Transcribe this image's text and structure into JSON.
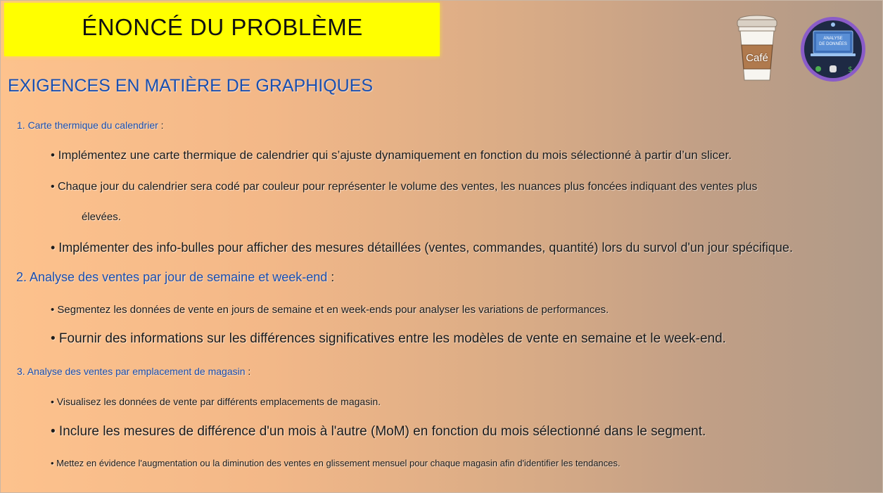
{
  "title": "ÉNONCÉ DU PROBLÈME",
  "heading": "EXIGENCES EN MATIÈRE DE GRAPHIQUES",
  "coffee_badge": {
    "label": "Café",
    "icon": "coffee-cup-icon"
  },
  "logo": {
    "icon": "data-logo-icon",
    "line1": "ANALYSE",
    "line2": "DE DONNÉES"
  },
  "sections": [
    {
      "heading": "1. Carte thermique du calendrier",
      "colon": " :",
      "bullets": [
        "• Implémentez une carte thermique de calendrier qui s’ajuste dynamiquement en fonction du mois sélectionné à partir d’un slicer.",
        "• Chaque jour du calendrier sera codé par couleur pour représenter le volume des ventes, les nuances plus foncées indiquant des ventes plus",
        "élevées.",
        "• Implémenter des info-bulles pour afficher des mesures détaillées (ventes, commandes, quantité) lors du survol d'un jour spécifique."
      ]
    },
    {
      "heading": "2. Analyse des ventes par jour de semaine et week-end",
      "colon": " :",
      "bullets": [
        "• Segmentez les données de vente en jours de semaine et en week-ends pour analyser les variations de performances.",
        "• Fournir des informations sur les différences significatives entre les modèles de vente en semaine et le week-end."
      ]
    },
    {
      "heading": "3. Analyse des ventes par emplacement de magasin",
      "colon": " :",
      "bullets": [
        "• Visualisez les données de vente par différents emplacements de magasin.",
        "• Inclure les mesures de différence d'un mois à l'autre (MoM) en fonction du mois sélectionné dans le segment.",
        "• Mettez en évidence l'augmentation ou la diminution des ventes en glissement mensuel pour chaque magasin afin d'identifier les tendances."
      ]
    }
  ]
}
